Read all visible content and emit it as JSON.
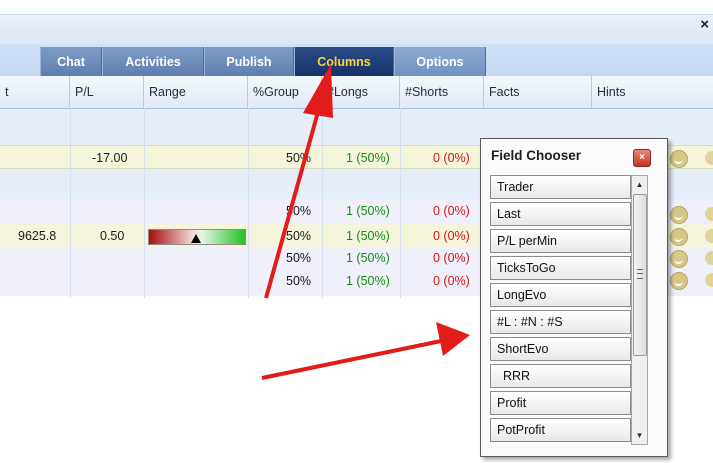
{
  "window": {
    "close_glyph": "×"
  },
  "tabs": [
    {
      "label": "Chat"
    },
    {
      "label": "Activities"
    },
    {
      "label": "Publish"
    },
    {
      "label": "Columns",
      "active": true
    },
    {
      "label": "Options"
    }
  ],
  "columns": [
    "t",
    "P/L",
    "Range",
    "%Group",
    "#Longs",
    "#Shorts",
    "Facts",
    "Hints"
  ],
  "rows": [
    {
      "pl": "-17.00",
      "group": "50%",
      "longs": "1 (50%)",
      "shorts": "0 (0%)"
    },
    {
      "group": "50%",
      "longs": "1 (50%)",
      "shorts": "0 (0%)"
    },
    {
      "last": "9625.8",
      "pl": "0.50",
      "group": "50%",
      "longs": "1 (50%)",
      "shorts": "0 (0%)"
    },
    {
      "group": "50%",
      "longs": "1 (50%)",
      "shorts": "0 (0%)"
    },
    {
      "group": "50%",
      "longs": "1 (50%)",
      "shorts": "0 (0%)"
    }
  ],
  "field_chooser": {
    "title": "Field Chooser",
    "close_glyph": "×",
    "fields": [
      "Trader",
      "Last",
      "P/L perMin",
      "TicksToGo",
      "LongEvo",
      "#L : #N : #S",
      "ShortEvo",
      "RRR",
      "Profit",
      "PotProfit"
    ]
  },
  "colors": {
    "active_tab_text": "#ffd23a",
    "arrow": "#e21b1b",
    "positive": "#178a17",
    "negative": "#d01515"
  },
  "icons": {
    "status": "smiley-icon",
    "scroll_up": "scroll-up-icon",
    "scroll_down": "scroll-down-icon"
  }
}
